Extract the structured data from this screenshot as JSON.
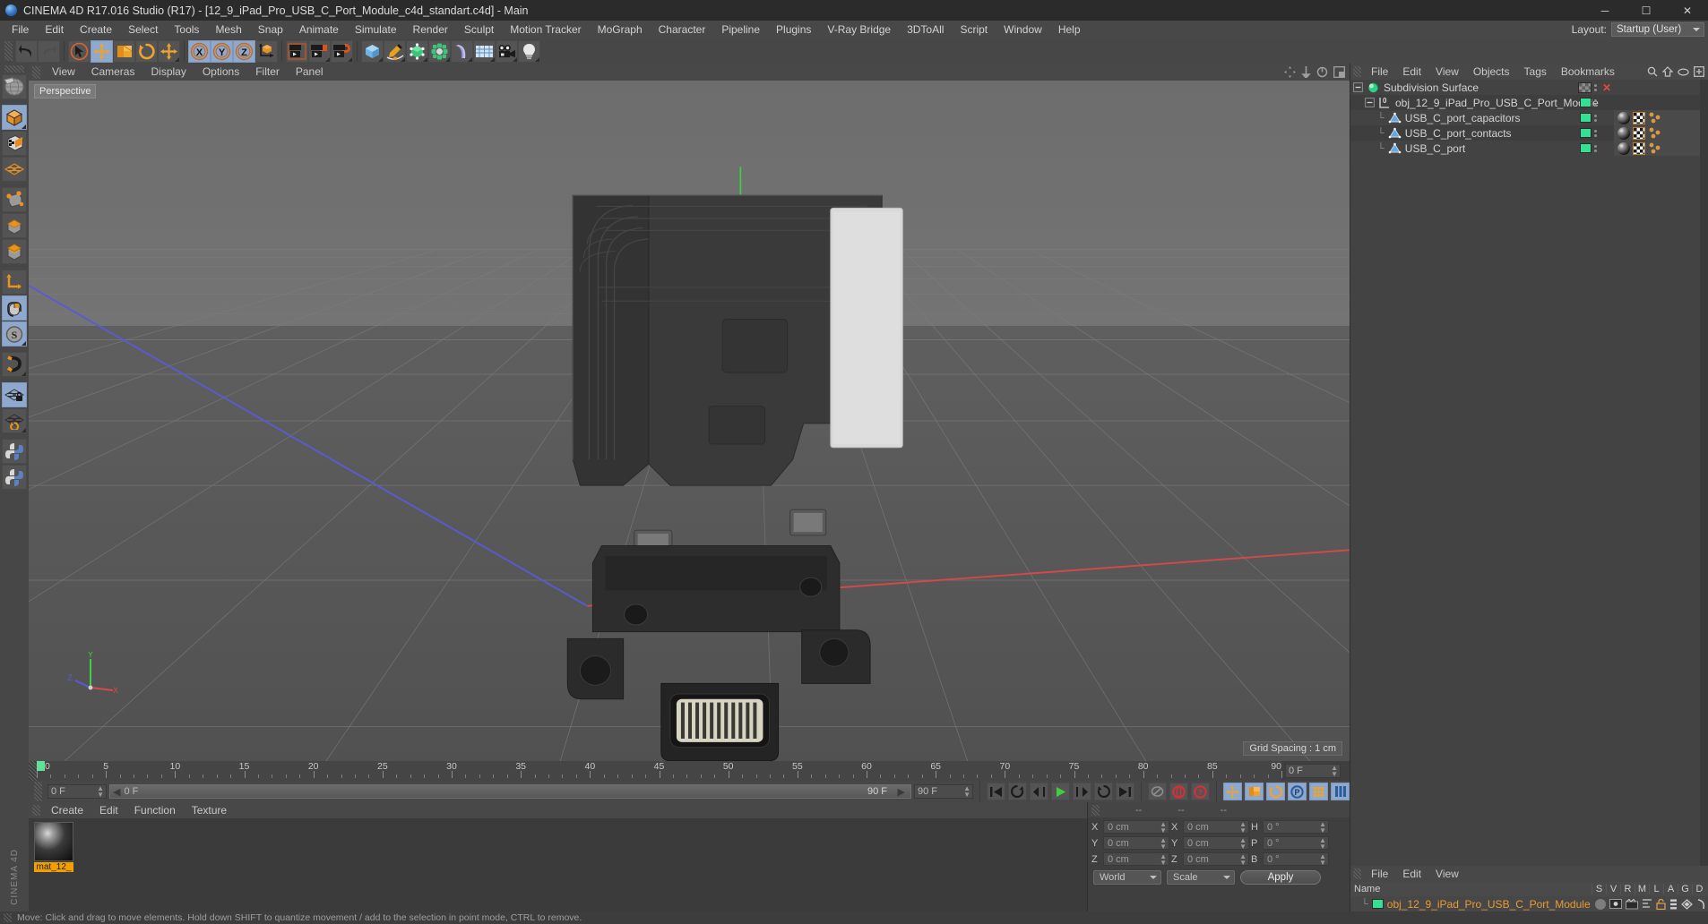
{
  "window": {
    "title": "CINEMA 4D R17.016 Studio (R17) - [12_9_iPad_Pro_USB_C_Port_Module_c4d_standart.c4d] - Main",
    "minimize": "─",
    "maximize": "☐",
    "close": "✕"
  },
  "menubar": {
    "items": [
      "File",
      "Edit",
      "Create",
      "Select",
      "Tools",
      "Mesh",
      "Snap",
      "Animate",
      "Simulate",
      "Render",
      "Sculpt",
      "Motion Tracker",
      "MoGraph",
      "Character",
      "Pipeline",
      "Plugins",
      "V-Ray Bridge",
      "3DToAll",
      "Script",
      "Window",
      "Help"
    ],
    "layout_label": "Layout:",
    "layout_value": "Startup (User)"
  },
  "toolbar": {
    "buttons": [
      {
        "name": "undo-button",
        "icon": "undo"
      },
      {
        "name": "redo-button",
        "icon": "redo"
      },
      {
        "name": "live-selection-button",
        "icon": "cursor-circle"
      },
      {
        "name": "move-tool-button",
        "icon": "move-arrows"
      },
      {
        "name": "scale-tool-button",
        "icon": "scale-box"
      },
      {
        "name": "rotate-tool-button",
        "icon": "rotate-circle"
      },
      {
        "name": "move-alt-button",
        "icon": "move-arrows"
      },
      {
        "name": "lock-x-axis-button",
        "icon": "axis-x"
      },
      {
        "name": "lock-y-axis-button",
        "icon": "axis-y"
      },
      {
        "name": "lock-z-axis-button",
        "icon": "axis-z"
      },
      {
        "name": "world-coordinate-button",
        "icon": "world-cube"
      },
      {
        "name": "render-view-button",
        "icon": "render-view"
      },
      {
        "name": "render-region-button",
        "icon": "render-region"
      },
      {
        "name": "render-settings-button",
        "icon": "render-settings"
      },
      {
        "name": "primitive-cube-button",
        "icon": "blue-cube"
      },
      {
        "name": "spline-pen-button",
        "icon": "pen-spline"
      },
      {
        "name": "nurbs-button",
        "icon": "green-cube"
      },
      {
        "name": "modeling-array-button",
        "icon": "green-array"
      },
      {
        "name": "deformer-button",
        "icon": "bend-deformer"
      },
      {
        "name": "environment-floor-button",
        "icon": "floor-grid"
      },
      {
        "name": "camera-button",
        "icon": "camera"
      },
      {
        "name": "light-button",
        "icon": "light-bulb"
      }
    ]
  },
  "left_toolbar": {
    "buttons": [
      {
        "name": "make-editable-button",
        "icon": "globe-mesh",
        "active": false
      },
      {
        "name": "model-mode-button",
        "icon": "orange-cube",
        "active": true
      },
      {
        "name": "texture-mode-button",
        "icon": "checker-cube",
        "active": false
      },
      {
        "name": "uv-mesh-button",
        "icon": "orange-mesh",
        "active": false
      },
      {
        "name": "point-mode-button",
        "icon": "point-cube",
        "active": false
      },
      {
        "name": "edge-mode-button",
        "icon": "edge-cube",
        "active": false
      },
      {
        "name": "polygon-mode-button",
        "icon": "polygon-cube",
        "active": false
      },
      {
        "name": "axis-modify-button",
        "icon": "axis-l",
        "active": false
      },
      {
        "name": "viewport-solo-button",
        "icon": "mouse",
        "active": true
      },
      {
        "name": "enable-snap-button",
        "icon": "s-circle",
        "active": true
      },
      {
        "name": "magnet-button",
        "icon": "magnet",
        "active": false
      },
      {
        "name": "lock-workplane-button",
        "icon": "grid-lock",
        "active": true
      },
      {
        "name": "workplane-button",
        "icon": "grid-rotate",
        "active": false
      },
      {
        "name": "python-script-button",
        "icon": "python",
        "active": false
      },
      {
        "name": "python-generator-button",
        "icon": "python",
        "active": false
      }
    ],
    "brand": "CINEMA 4D"
  },
  "viewport": {
    "menu": [
      "View",
      "Cameras",
      "Display",
      "Options",
      "Filter",
      "Panel"
    ],
    "label": "Perspective",
    "grid_spacing": "Grid Spacing : 1 cm",
    "axis_x": "X",
    "axis_y": "Y",
    "axis_z": "Z",
    "nav_icons": [
      "pan-icon",
      "dolly-icon",
      "orbit-icon",
      "maximize-view-icon"
    ]
  },
  "timeline": {
    "ticks": [
      0,
      5,
      10,
      15,
      20,
      25,
      30,
      35,
      40,
      45,
      50,
      55,
      60,
      65,
      70,
      75,
      80,
      85,
      90
    ],
    "current_frame_field": "0 F",
    "start_field": "0 F",
    "end_field_display": "90 F",
    "end_field": "90 F",
    "preview_start": "0 F",
    "right_frame_field": "0 F"
  },
  "anim_controls": {
    "buttons": [
      {
        "name": "goto-start-button",
        "icon": "skip-start"
      },
      {
        "name": "previous-keyframe-button",
        "icon": "prev-key"
      },
      {
        "name": "step-back-button",
        "icon": "step-back"
      },
      {
        "name": "play-button",
        "icon": "play"
      },
      {
        "name": "step-forward-button",
        "icon": "step-forward"
      },
      {
        "name": "next-keyframe-button",
        "icon": "next-key"
      },
      {
        "name": "goto-end-button",
        "icon": "skip-end"
      },
      {
        "name": "autokey-button",
        "icon": "autokey"
      },
      {
        "name": "record-active-button",
        "icon": "record"
      },
      {
        "name": "keyframe-selection-button",
        "icon": "key-question"
      },
      {
        "name": "position-key-button",
        "icon": "move-key"
      },
      {
        "name": "scale-key-button",
        "icon": "scale-key"
      },
      {
        "name": "rotation-key-button",
        "icon": "rotate-key"
      },
      {
        "name": "pla-key-button",
        "icon": "p-key"
      },
      {
        "name": "param-key-button",
        "icon": "param-dots"
      },
      {
        "name": "timeline-toggle-button",
        "icon": "timeline-bars"
      }
    ]
  },
  "material_manager": {
    "menu": [
      "Create",
      "Edit",
      "Function",
      "Texture"
    ],
    "materials": [
      {
        "name": "mat_12_"
      }
    ]
  },
  "coordinates": {
    "header_dashes": [
      "--",
      "--",
      "--"
    ],
    "rows": [
      {
        "label1": "X",
        "value1": "0 cm",
        "label2": "X",
        "value2": "0 cm",
        "label3": "H",
        "value3": "0 °"
      },
      {
        "label1": "Y",
        "value1": "0 cm",
        "label2": "Y",
        "value2": "0 cm",
        "label3": "P",
        "value3": "0 °"
      },
      {
        "label1": "Z",
        "value1": "0 cm",
        "label2": "Z",
        "value2": "0 cm",
        "label3": "B",
        "value3": "0 °"
      }
    ],
    "system_dropdown": "World",
    "mode_dropdown": "Scale",
    "apply_label": "Apply"
  },
  "object_manager": {
    "menu": [
      "File",
      "Edit",
      "View",
      "Objects",
      "Tags",
      "Bookmarks"
    ],
    "header_icons": [
      "search-icon",
      "home-icon",
      "eye-icon",
      "new-layer-icon"
    ],
    "items": [
      {
        "name": "Subdivision Surface",
        "depth": 0,
        "icon": "subdivision-surface-icon",
        "chip": false,
        "tags": false,
        "close_x": true
      },
      {
        "name": "obj_12_9_iPad_Pro_USB_C_Port_Module",
        "depth": 1,
        "icon": "null-object-icon",
        "chip": true,
        "tags": false,
        "close_x": false
      },
      {
        "name": "USB_C_port_capacitors",
        "depth": 2,
        "icon": "polygon-object-icon",
        "chip": true,
        "tags": true,
        "close_x": false
      },
      {
        "name": "USB_C_port_contacts",
        "depth": 2,
        "icon": "polygon-object-icon",
        "chip": true,
        "tags": true,
        "close_x": false
      },
      {
        "name": "USB_C_port",
        "depth": 2,
        "icon": "polygon-object-icon",
        "chip": true,
        "tags": true,
        "close_x": false
      }
    ]
  },
  "attribute_manager": {
    "menu": [
      "File",
      "Edit",
      "View"
    ],
    "name_header": "Name",
    "columns": [
      "S",
      "V",
      "R",
      "M",
      "L",
      "A",
      "G",
      "D"
    ],
    "rows": [
      {
        "name": "obj_12_9_iPad_Pro_USB_C_Port_Module"
      }
    ]
  },
  "statusbar": {
    "text": "Move: Click and drag to move elements. Hold down SHIFT to quantize movement / add to the selection in point mode, CTRL to remove."
  }
}
